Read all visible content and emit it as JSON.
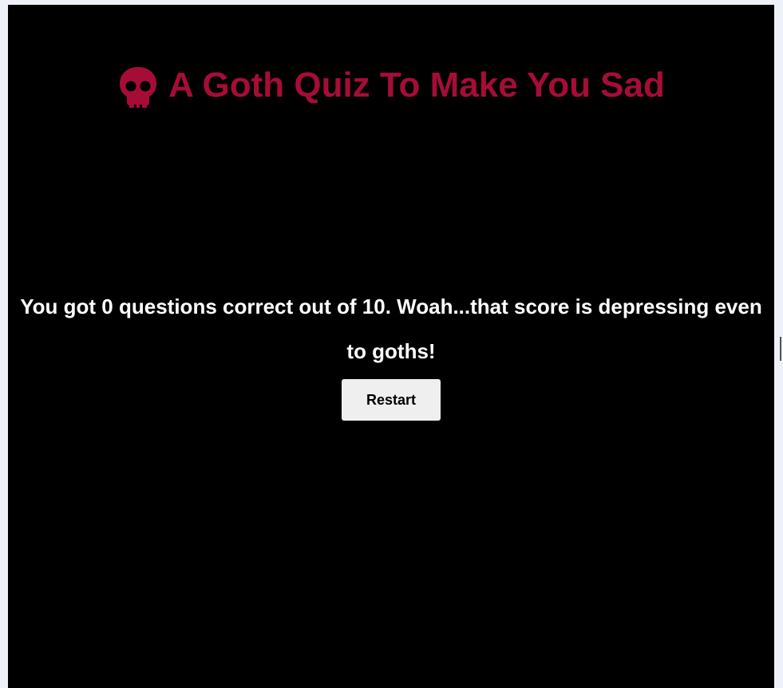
{
  "header": {
    "title": "A Goth Quiz To Make You Sad",
    "icon": "skull-icon"
  },
  "result": {
    "message": "You got 0 questions correct out of 10. Woah...that score is depressing even to goths!"
  },
  "actions": {
    "restart_label": "Restart"
  },
  "colors": {
    "background": "#000000",
    "title": "#a50d37",
    "text": "#ffffff",
    "button_bg": "#efefef"
  }
}
